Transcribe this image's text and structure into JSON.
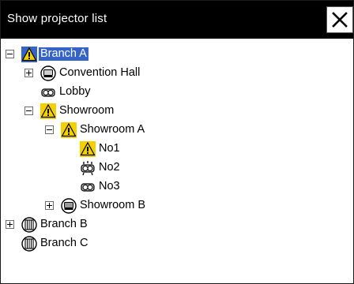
{
  "window": {
    "title": "Show projector list"
  },
  "tree": {
    "branch_a": "Branch A",
    "convention_hall": "Convention Hall",
    "lobby": "Lobby",
    "showroom": "Showroom",
    "showroom_a": "Showroom A",
    "no1": "No1",
    "no2": "No2",
    "no3": "No3",
    "showroom_b": "Showroom B",
    "branch_b": "Branch B",
    "branch_c": "Branch C"
  },
  "colors": {
    "selection": "#3464c8",
    "warning": "#f5d000",
    "titlebar": "#000000"
  }
}
